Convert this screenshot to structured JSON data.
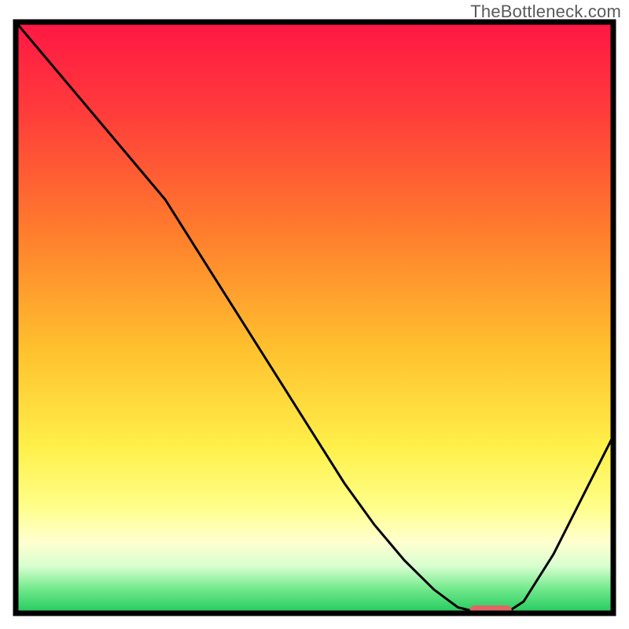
{
  "watermark": "TheBottleneck.com",
  "chart_data": {
    "type": "line",
    "x": [
      0,
      5,
      10,
      15,
      20,
      25,
      30,
      35,
      40,
      45,
      50,
      55,
      60,
      65,
      70,
      74,
      78,
      82,
      85,
      90,
      95,
      100
    ],
    "values": [
      100,
      94,
      88,
      82,
      76,
      70,
      62,
      54,
      46,
      38,
      30,
      22,
      15,
      9,
      4,
      1,
      0,
      0,
      2,
      10,
      20,
      30
    ],
    "title": "",
    "xlabel": "",
    "ylabel": "",
    "xlim": [
      0,
      100
    ],
    "ylim": [
      0,
      100
    ],
    "marker": {
      "x_start": 76,
      "x_end": 83,
      "y": 0,
      "color": "#e06666"
    },
    "background_gradient_stops": [
      {
        "offset": 0.0,
        "color": "#ff1744"
      },
      {
        "offset": 0.15,
        "color": "#ff3b3b"
      },
      {
        "offset": 0.35,
        "color": "#ff7b2d"
      },
      {
        "offset": 0.55,
        "color": "#ffc02e"
      },
      {
        "offset": 0.72,
        "color": "#fff04a"
      },
      {
        "offset": 0.82,
        "color": "#ffff8a"
      },
      {
        "offset": 0.88,
        "color": "#ffffd0"
      },
      {
        "offset": 0.92,
        "color": "#d9ffd0"
      },
      {
        "offset": 0.96,
        "color": "#6fe88a"
      },
      {
        "offset": 1.0,
        "color": "#22c95e"
      }
    ],
    "frame": {
      "stroke": "#000000",
      "width": 7
    }
  }
}
